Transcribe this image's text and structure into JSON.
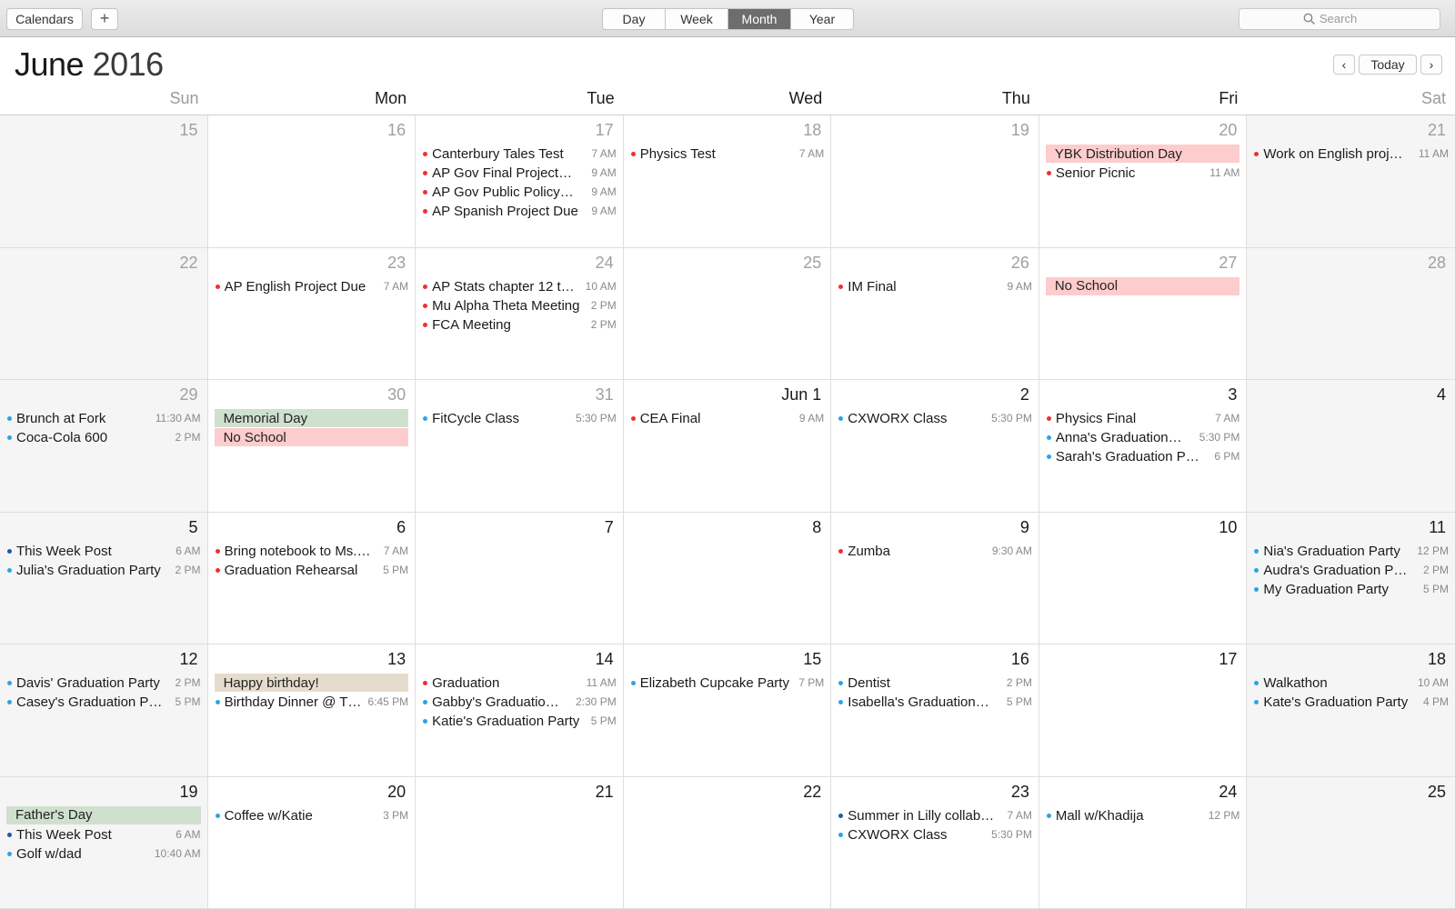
{
  "toolbar": {
    "calendars_label": "Calendars",
    "add_label": "+",
    "views": [
      {
        "label": "Day",
        "active": false
      },
      {
        "label": "Week",
        "active": false
      },
      {
        "label": "Month",
        "active": true
      },
      {
        "label": "Year",
        "active": false
      }
    ],
    "search_placeholder": "Search"
  },
  "header": {
    "month": "June",
    "year": "2016",
    "prev_label": "‹",
    "today_label": "Today",
    "next_label": "›"
  },
  "weekdays": [
    "Sun",
    "Mon",
    "Tue",
    "Wed",
    "Thu",
    "Fri",
    "Sat"
  ],
  "colors": {
    "dot_red": "#f0302b",
    "dot_blue": "#2aa4e8",
    "dot_darkblue": "#1e5ba8",
    "allday_red": "#fdcccc",
    "allday_green": "#cfe0cf",
    "allday_tan": "#e6dccd"
  },
  "weeks": [
    [
      {
        "day": "15",
        "muted": true,
        "events": []
      },
      {
        "day": "16",
        "muted": true,
        "events": []
      },
      {
        "day": "17",
        "muted": true,
        "events": [
          {
            "title": "Canterbury Tales Test",
            "time": "7 AM",
            "color": "red"
          },
          {
            "title": "AP Gov Final Project…",
            "time": "9 AM",
            "color": "red"
          },
          {
            "title": "AP Gov Public Policy…",
            "time": "9 AM",
            "color": "red"
          },
          {
            "title": "AP Spanish Project Due",
            "time": "9 AM",
            "color": "red"
          }
        ]
      },
      {
        "day": "18",
        "muted": true,
        "events": [
          {
            "title": "Physics Test",
            "time": "7 AM",
            "color": "red"
          }
        ]
      },
      {
        "day": "19",
        "muted": true,
        "events": []
      },
      {
        "day": "20",
        "muted": true,
        "events": [
          {
            "title": "YBK Distribution Day",
            "allday": "red"
          },
          {
            "title": "Senior Picnic",
            "time": "11 AM",
            "color": "red"
          }
        ]
      },
      {
        "day": "21",
        "muted": true,
        "events": [
          {
            "title": "Work on English proj…",
            "time": "11 AM",
            "color": "red"
          }
        ]
      }
    ],
    [
      {
        "day": "22",
        "muted": true,
        "events": []
      },
      {
        "day": "23",
        "muted": true,
        "events": [
          {
            "title": "AP English Project Due",
            "time": "7 AM",
            "color": "red"
          }
        ]
      },
      {
        "day": "24",
        "muted": true,
        "events": [
          {
            "title": "AP Stats chapter 12 t…",
            "time": "10 AM",
            "color": "red"
          },
          {
            "title": "Mu Alpha Theta Meeting",
            "time": "2 PM",
            "color": "red"
          },
          {
            "title": "FCA Meeting",
            "time": "2 PM",
            "color": "red"
          }
        ]
      },
      {
        "day": "25",
        "muted": true,
        "events": []
      },
      {
        "day": "26",
        "muted": true,
        "events": [
          {
            "title": "IM Final",
            "time": "9 AM",
            "color": "red"
          }
        ]
      },
      {
        "day": "27",
        "muted": true,
        "events": [
          {
            "title": "No School",
            "allday": "red"
          }
        ]
      },
      {
        "day": "28",
        "muted": true,
        "events": []
      }
    ],
    [
      {
        "day": "29",
        "muted": true,
        "events": [
          {
            "title": "Brunch at Fork",
            "time": "11:30 AM",
            "color": "blue"
          },
          {
            "title": "Coca-Cola 600",
            "time": "2 PM",
            "color": "blue"
          }
        ]
      },
      {
        "day": "30",
        "muted": true,
        "events": [
          {
            "title": "Memorial Day",
            "allday": "green"
          },
          {
            "title": "No School",
            "allday": "red"
          }
        ]
      },
      {
        "day": "31",
        "muted": true,
        "events": [
          {
            "title": "FitCycle Class",
            "time": "5:30 PM",
            "color": "blue"
          }
        ]
      },
      {
        "day": "Jun 1",
        "muted": false,
        "events": [
          {
            "title": "CEA Final",
            "time": "9 AM",
            "color": "red"
          }
        ]
      },
      {
        "day": "2",
        "muted": false,
        "events": [
          {
            "title": "CXWORX Class",
            "time": "5:30 PM",
            "color": "blue"
          }
        ]
      },
      {
        "day": "3",
        "muted": false,
        "events": [
          {
            "title": "Physics Final",
            "time": "7 AM",
            "color": "red"
          },
          {
            "title": "Anna's Graduation…",
            "time": "5:30 PM",
            "color": "blue"
          },
          {
            "title": "Sarah's Graduation P…",
            "time": "6 PM",
            "color": "blue"
          }
        ]
      },
      {
        "day": "4",
        "muted": false,
        "events": []
      }
    ],
    [
      {
        "day": "5",
        "muted": false,
        "events": [
          {
            "title": "This Week Post",
            "time": "6 AM",
            "color": "darkblue"
          },
          {
            "title": "Julia's Graduation Party",
            "time": "2 PM",
            "color": "blue"
          }
        ]
      },
      {
        "day": "6",
        "muted": false,
        "events": [
          {
            "title": "Bring notebook to Ms.…",
            "time": "7 AM",
            "color": "red"
          },
          {
            "title": "Graduation Rehearsal",
            "time": "5 PM",
            "color": "red"
          }
        ]
      },
      {
        "day": "7",
        "muted": false,
        "events": []
      },
      {
        "day": "8",
        "muted": false,
        "events": []
      },
      {
        "day": "9",
        "muted": false,
        "events": [
          {
            "title": "Zumba",
            "time": "9:30 AM",
            "color": "red"
          }
        ]
      },
      {
        "day": "10",
        "muted": false,
        "events": []
      },
      {
        "day": "11",
        "muted": false,
        "events": [
          {
            "title": "Nia's Graduation Party",
            "time": "12 PM",
            "color": "blue"
          },
          {
            "title": "Audra's Graduation P…",
            "time": "2 PM",
            "color": "blue"
          },
          {
            "title": "My Graduation Party",
            "time": "5 PM",
            "color": "blue"
          }
        ]
      }
    ],
    [
      {
        "day": "12",
        "muted": false,
        "events": [
          {
            "title": "Davis' Graduation Party",
            "time": "2 PM",
            "color": "blue"
          },
          {
            "title": "Casey's Graduation P…",
            "time": "5 PM",
            "color": "blue"
          }
        ]
      },
      {
        "day": "13",
        "muted": false,
        "events": [
          {
            "title": "Happy birthday!",
            "allday": "tan"
          },
          {
            "title": "Birthday Dinner @ T…",
            "time": "6:45 PM",
            "color": "blue"
          }
        ]
      },
      {
        "day": "14",
        "muted": false,
        "events": [
          {
            "title": "Graduation",
            "time": "11 AM",
            "color": "red"
          },
          {
            "title": "Gabby's Graduatio…",
            "time": "2:30 PM",
            "color": "blue"
          },
          {
            "title": "Katie's Graduation Party",
            "time": "5 PM",
            "color": "blue"
          }
        ]
      },
      {
        "day": "15",
        "muted": false,
        "events": [
          {
            "title": "Elizabeth Cupcake Party",
            "time": "7 PM",
            "color": "blue"
          }
        ]
      },
      {
        "day": "16",
        "muted": false,
        "events": [
          {
            "title": "Dentist",
            "time": "2 PM",
            "color": "blue"
          },
          {
            "title": "Isabella's Graduation…",
            "time": "5 PM",
            "color": "blue"
          }
        ]
      },
      {
        "day": "17",
        "muted": false,
        "events": []
      },
      {
        "day": "18",
        "muted": false,
        "events": [
          {
            "title": "Walkathon",
            "time": "10 AM",
            "color": "blue"
          },
          {
            "title": "Kate's Graduation Party",
            "time": "4 PM",
            "color": "blue"
          }
        ]
      }
    ],
    [
      {
        "day": "19",
        "muted": false,
        "events": [
          {
            "title": "Father's Day",
            "allday": "green"
          },
          {
            "title": "This Week Post",
            "time": "6 AM",
            "color": "darkblue"
          },
          {
            "title": "Golf w/dad",
            "time": "10:40 AM",
            "color": "blue"
          }
        ]
      },
      {
        "day": "20",
        "muted": false,
        "events": [
          {
            "title": "Coffee w/Katie",
            "time": "3 PM",
            "color": "blue"
          }
        ]
      },
      {
        "day": "21",
        "muted": false,
        "events": []
      },
      {
        "day": "22",
        "muted": false,
        "events": []
      },
      {
        "day": "23",
        "muted": false,
        "events": [
          {
            "title": "Summer in Lilly collab…",
            "time": "7 AM",
            "color": "darkblue"
          },
          {
            "title": "CXWORX Class",
            "time": "5:30 PM",
            "color": "blue"
          }
        ]
      },
      {
        "day": "24",
        "muted": false,
        "events": [
          {
            "title": "Mall w/Khadija",
            "time": "12 PM",
            "color": "blue"
          }
        ]
      },
      {
        "day": "25",
        "muted": false,
        "events": []
      }
    ]
  ]
}
